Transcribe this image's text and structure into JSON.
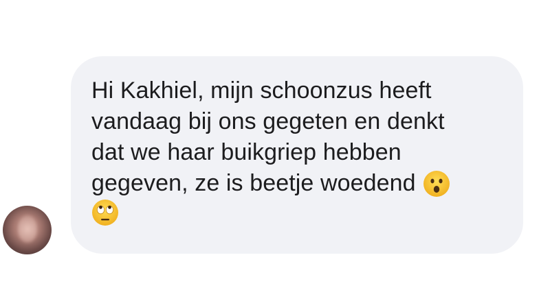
{
  "message": {
    "lines": [
      "Hi Kakhiel, mijn schoonzus heeft",
      "vandaag bij ons gegeten en denkt",
      "dat we haar buikgriep hebben",
      "gegeven, ze is beetje woedend"
    ],
    "emojis": [
      "astonished-face-emoji",
      "eye-roll-emoji"
    ]
  },
  "colors": {
    "bubble": "#f1f2f6",
    "text": "#1c1c1e",
    "emoji_yellow": "#f7c431"
  }
}
